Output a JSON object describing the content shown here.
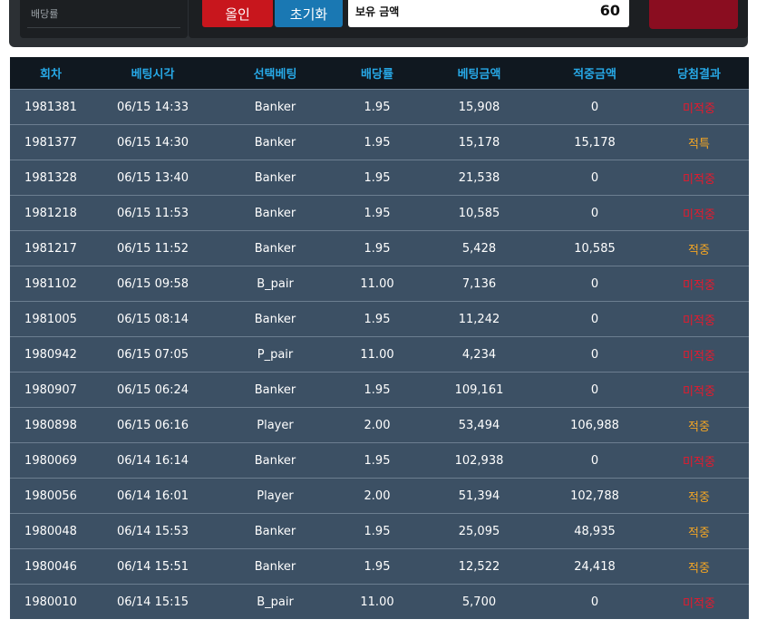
{
  "controls": {
    "rate_label": "배당률",
    "allin_label": "올인",
    "reset_label": "초기화",
    "balance_label": "보유 금액",
    "balance_value": "60"
  },
  "colors": {
    "header_bg": "#101820",
    "header_text": "#27a8e6",
    "row_bg": "#3c5064",
    "loss": "#e8192c",
    "win": "#f5a623",
    "allin_button": "#c8161d",
    "reset_button": "#1a78b3",
    "bet_button": "#8a0d20"
  },
  "table": {
    "headers": [
      "회차",
      "베팅시각",
      "선택베팅",
      "배당률",
      "베팅금액",
      "적중금액",
      "당첨결과"
    ],
    "rows": [
      {
        "round": "1981381",
        "time": "06/15 14:33",
        "bet": "Banker",
        "odds": "1.95",
        "amount": "15,908",
        "payout": "0",
        "result": "미적중",
        "status": "loss"
      },
      {
        "round": "1981377",
        "time": "06/15 14:30",
        "bet": "Banker",
        "odds": "1.95",
        "amount": "15,178",
        "payout": "15,178",
        "result": "적특",
        "status": "win"
      },
      {
        "round": "1981328",
        "time": "06/15 13:40",
        "bet": "Banker",
        "odds": "1.95",
        "amount": "21,538",
        "payout": "0",
        "result": "미적중",
        "status": "loss"
      },
      {
        "round": "1981218",
        "time": "06/15 11:53",
        "bet": "Banker",
        "odds": "1.95",
        "amount": "10,585",
        "payout": "0",
        "result": "미적중",
        "status": "loss"
      },
      {
        "round": "1981217",
        "time": "06/15 11:52",
        "bet": "Banker",
        "odds": "1.95",
        "amount": "5,428",
        "payout": "10,585",
        "result": "적중",
        "status": "win"
      },
      {
        "round": "1981102",
        "time": "06/15 09:58",
        "bet": "B_pair",
        "odds": "11.00",
        "amount": "7,136",
        "payout": "0",
        "result": "미적중",
        "status": "loss"
      },
      {
        "round": "1981005",
        "time": "06/15 08:14",
        "bet": "Banker",
        "odds": "1.95",
        "amount": "11,242",
        "payout": "0",
        "result": "미적중",
        "status": "loss"
      },
      {
        "round": "1980942",
        "time": "06/15 07:05",
        "bet": "P_pair",
        "odds": "11.00",
        "amount": "4,234",
        "payout": "0",
        "result": "미적중",
        "status": "loss"
      },
      {
        "round": "1980907",
        "time": "06/15 06:24",
        "bet": "Banker",
        "odds": "1.95",
        "amount": "109,161",
        "payout": "0",
        "result": "미적중",
        "status": "loss"
      },
      {
        "round": "1980898",
        "time": "06/15 06:16",
        "bet": "Player",
        "odds": "2.00",
        "amount": "53,494",
        "payout": "106,988",
        "result": "적중",
        "status": "win"
      },
      {
        "round": "1980069",
        "time": "06/14 16:14",
        "bet": "Banker",
        "odds": "1.95",
        "amount": "102,938",
        "payout": "0",
        "result": "미적중",
        "status": "loss"
      },
      {
        "round": "1980056",
        "time": "06/14 16:01",
        "bet": "Player",
        "odds": "2.00",
        "amount": "51,394",
        "payout": "102,788",
        "result": "적중",
        "status": "win"
      },
      {
        "round": "1980048",
        "time": "06/14 15:53",
        "bet": "Banker",
        "odds": "1.95",
        "amount": "25,095",
        "payout": "48,935",
        "result": "적중",
        "status": "win"
      },
      {
        "round": "1980046",
        "time": "06/14 15:51",
        "bet": "Banker",
        "odds": "1.95",
        "amount": "12,522",
        "payout": "24,418",
        "result": "적중",
        "status": "win"
      },
      {
        "round": "1980010",
        "time": "06/14 15:15",
        "bet": "B_pair",
        "odds": "11.00",
        "amount": "5,700",
        "payout": "0",
        "result": "미적중",
        "status": "loss"
      }
    ]
  }
}
